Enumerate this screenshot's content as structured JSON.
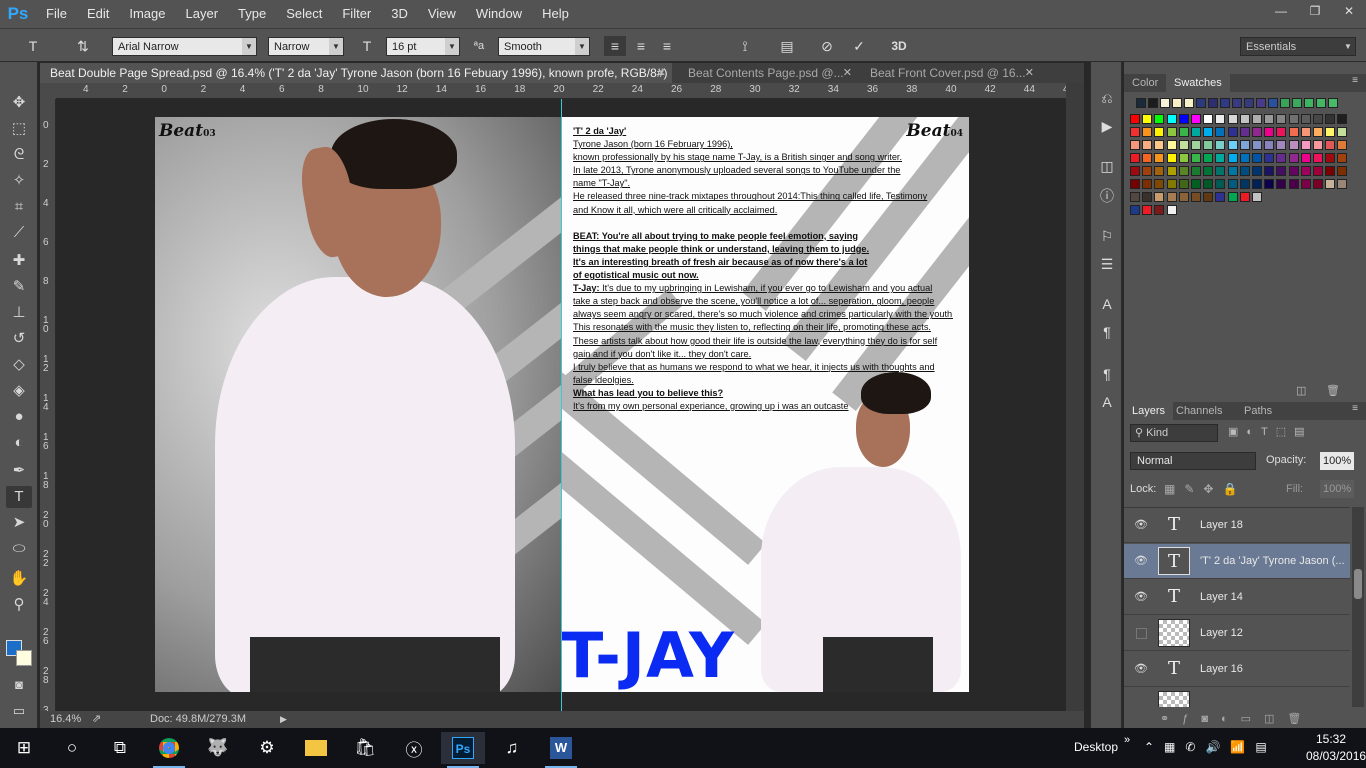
{
  "app": {
    "logo": "Ps"
  },
  "menu": [
    "File",
    "Edit",
    "Image",
    "Layer",
    "Type",
    "Select",
    "Filter",
    "3D",
    "View",
    "Window",
    "Help"
  ],
  "window_controls": {
    "minimize": "—",
    "restore": "❐",
    "close": "✕"
  },
  "options": {
    "font_family": "Arial Narrow",
    "font_style": "Narrow",
    "font_size": "16 pt",
    "antialias_label": "ªa",
    "antialias": "Smooth",
    "workspace": "Essentials",
    "text_color": "#000000"
  },
  "tabs": [
    {
      "label": "Beat Double Page Spread.psd @ 16.4% ('T' 2 da 'Jay' Tyrone Jason (born 16 Febuary 1996), known profe, RGB/8#) *",
      "close": "✕"
    },
    {
      "label": "Beat Contents Page.psd @...",
      "close": "✕"
    },
    {
      "label": "Beat Front Cover.psd @ 16...",
      "close": "✕"
    }
  ],
  "ruler": {
    "top": [
      "4",
      "2",
      "0",
      "2",
      "4",
      "6",
      "8",
      "10",
      "12",
      "14",
      "16",
      "18",
      "20",
      "22",
      "24",
      "26",
      "28",
      "30",
      "32",
      "34",
      "36",
      "38",
      "40",
      "42",
      "44",
      "46"
    ],
    "left": [
      "0",
      "2",
      "4",
      "6",
      "8",
      "10",
      "12",
      "14",
      "16",
      "18",
      "20",
      "22",
      "24",
      "26",
      "28",
      "30",
      "32"
    ]
  },
  "spread": {
    "left_logo": "Beat",
    "left_page_num": "03",
    "right_logo": "Beat",
    "right_page_num": "04",
    "headline": "T-JAY",
    "headline_color": "#0b2af2",
    "article": {
      "title": "'T' 2 da 'Jay'",
      "lines": [
        "Tyrone Jason (born 16 February 1996),",
        "known professionally by his stage name T-Jay, is a British singer and song writer.",
        "In late 2013, Tyrone anonymously uploaded several songs to YouTube under the",
        "name \"T-Jay\".",
        "He released three nine-track mixtapes throughout 2014:This thing called life, Testimony",
        "and Know it all, which were all critically acclaimed."
      ],
      "question1": [
        "BEAT: You're all about trying to make people feel emotion, saying",
        "things that make people think or understand, leaving them to judge.",
        "It's an interesting breath of fresh air because as of now there's a lot",
        "of egotistical music out now."
      ],
      "answer1_label": "T-Jay:",
      "answer1": [
        " It's due to my upbringing in Lewisham, if you ever go to Lewisham and you actual",
        "take a step back and observe the scene, you'll notice a lot of... seperation, gloom, people",
        "always seem angry or scared, there's so much violence and crimes particularly with the youth.",
        "This resonates with the music they listen to, reflecting on their life, promoting these acts.",
        "These artists talk about how good their life is outside the law, everything they do is for self",
        "gain and if you don't like it... they don't care.",
        "I truly believe that as humans we respond to what we hear, it injects us with thoughts and",
        "false ideolgies."
      ],
      "question2": "What has lead you to believe this?",
      "answer2": "It's from my own personal experiance, growing up i was an outcaste"
    }
  },
  "status": {
    "zoom": "16.4%",
    "doc": "Doc: 49.8M/279.3M"
  },
  "panels": {
    "color_tab": "Color",
    "swatches_tab": "Swatches",
    "layers_tab": "Layers",
    "channels_tab": "Channels",
    "paths_tab": "Paths",
    "kind_label": "Kind",
    "blend_mode": "Normal",
    "opacity_label": "Opacity:",
    "opacity": "100%",
    "lock_label": "Lock:",
    "fill_label": "Fill:",
    "fill": "100%"
  },
  "layers": [
    {
      "name": "Layer 18",
      "type": "text",
      "visible": true,
      "selected": false
    },
    {
      "name": "'T' 2 da 'Jay' Tyrone Jason (...",
      "type": "text",
      "visible": true,
      "selected": true
    },
    {
      "name": "Layer 14",
      "type": "text",
      "visible": true,
      "selected": false
    },
    {
      "name": "Layer 12",
      "type": "image",
      "visible": false,
      "selected": false
    },
    {
      "name": "Layer 16",
      "type": "text",
      "visible": true,
      "selected": false
    }
  ],
  "taskbar": {
    "desktop_label": "Desktop",
    "time": "15:32",
    "date": "08/03/2016"
  }
}
